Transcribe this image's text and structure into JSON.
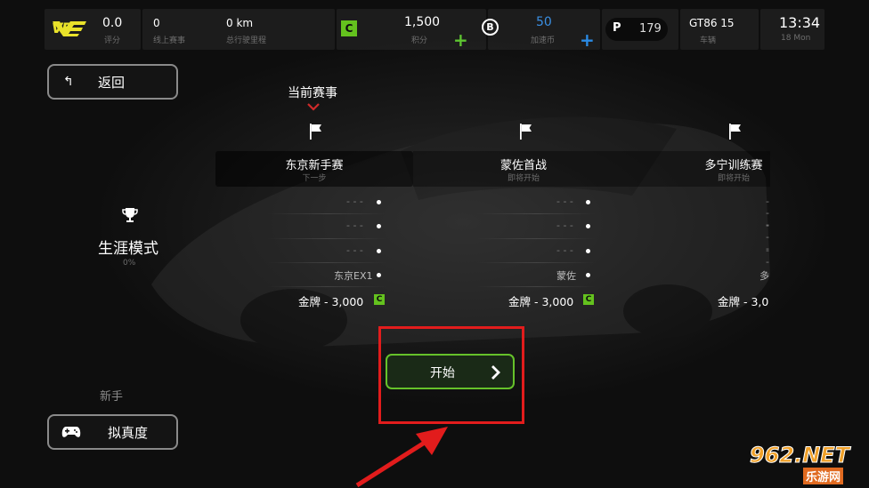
{
  "topbar": {
    "logo": "VE",
    "rating_value": "0.0",
    "rating_label": "评分",
    "online_races_value": "0",
    "online_races_label": "线上赛事",
    "distance_value": "0 km",
    "distance_label": "总行驶里程",
    "tier_badge": "C",
    "points_value": "1,500",
    "points_label": "积分",
    "booster_badge": "B",
    "booster_value": "50",
    "booster_label": "加速币",
    "p_badge": "P",
    "p_value": "179",
    "car_value": "GT86 15",
    "car_label": "车辆",
    "time_value": "13:34",
    "date_value": "18 Mon"
  },
  "back_button": {
    "label": "返回"
  },
  "mode": {
    "title": "生涯模式",
    "progress": "0%"
  },
  "difficulty": {
    "caption": "新手",
    "button_label": "拟真度"
  },
  "current_event_label": "当前赛事",
  "events": [
    {
      "name": "东京新手赛",
      "status": "下一步",
      "track": "东京EX1",
      "prize": "金牌 - 3,000",
      "badge": "C"
    },
    {
      "name": "蒙佐首战",
      "status": "即将开始",
      "track": "蒙佐",
      "prize": "金牌 - 3,000",
      "badge": "C"
    },
    {
      "name": "多宁训练赛",
      "status": "即将开始",
      "track": "多",
      "prize": "金牌 - 3,0",
      "badge": ""
    }
  ],
  "dashes": "- - -",
  "start_button": {
    "label": "开始"
  },
  "watermark": {
    "main": "962.NET",
    "sub": "乐游网"
  },
  "colors": {
    "accent_green": "#64c21e",
    "plus_green": "#5ec531",
    "plus_blue": "#2a8be6",
    "booster_blue": "#3a8fe3",
    "highlight_red": "#e21c1c",
    "logo_yellow": "#e9e22a"
  }
}
